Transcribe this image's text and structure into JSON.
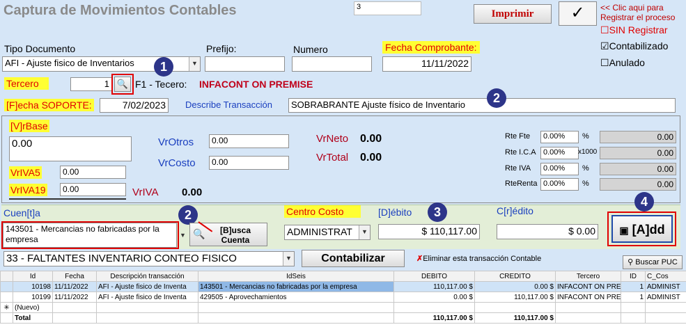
{
  "title": "Captura de Movimientos Contables",
  "top_input_value": "3",
  "print_label": "Imprimir",
  "register_hint_line1": "<< Clic aqui para",
  "register_hint_line2": "Registrar el proceso",
  "checks": {
    "sin_registrar": "SIN Registrar",
    "contabilizado": "Contabilizado",
    "anulado": "Anulado",
    "sin_registrar_mark": "☐",
    "contabilizado_mark": "☑",
    "anulado_mark": "☐"
  },
  "labels": {
    "tipo_documento": "Tipo Documento",
    "prefijo": "Prefijo:",
    "numero": "Numero",
    "fecha_comprobante": "Fecha Comprobante:",
    "tercero": "Tercero",
    "f1_tercero": "F1 - Tecero:",
    "fecha_soporte": "[F]echa SOPORTE:",
    "describe_transaccion": "Describe Transacción",
    "vrbase": "[V]rBase",
    "vrotros": "VrOtros",
    "vrcosto": "VrCosto",
    "vrneto": "VrNeto",
    "vrtotal": "VrTotal",
    "vriva5": "VrIVA5",
    "vriva19": "VrIVA19",
    "vriva": "VrIVA",
    "rte_fte": "Rte Fte",
    "rte_ica": "Rte I.C.A",
    "rte_iva": "Rte IVA",
    "rte_renta": "RteRenta",
    "pct": "%",
    "x1000": "x1000",
    "cuenta": "Cuen[t]a",
    "buscar_cuenta_1": "[B]usca",
    "buscar_cuenta_2": "Cuenta",
    "centro_costo": "Centro Costo",
    "debito": "[D]ébito",
    "credito": "C[r]édito",
    "add": "[A]dd",
    "contabilizar": "Contabilizar",
    "eliminar": "Eliminar esta transacción Contable",
    "buscar_puc": "Buscar PUC"
  },
  "values": {
    "tipo_documento": "AFI - Ajuste fisico de Inventarios",
    "prefijo": "",
    "numero": "",
    "fecha_comprobante": "11/11/2022",
    "tercero_id": "1",
    "tercero_name": "INFACONT ON PREMISE",
    "fecha_soporte": "7/02/2023",
    "describe_transaccion": "SOBRABRANTE Ajuste físico de Inventario",
    "vrbase": "0.00",
    "vrotros": "0.00",
    "vrcosto": "0.00",
    "vrneto": "0.00",
    "vrtotal": "0.00",
    "vriva5": "0.00",
    "vriva19": "0.00",
    "vriva": "0.00",
    "rte_fte_pct": "0.00%",
    "rte_ica_pct": "0.00%",
    "rte_iva_pct": "0.00%",
    "rte_renta_pct": "0.00%",
    "rte_fte_val": "0.00",
    "rte_ica_val": "0.00",
    "rte_iva_val": "0.00",
    "rte_renta_val": "0.00",
    "cuenta": "143501 - Mercancias no fabricadas por la empresa",
    "centro_costo": "ADMINISTRAT",
    "debito": "$ 110,117.00",
    "credito": "$ 0.00",
    "concepto": "33 - FALTANTES INVENTARIO CONTEO FISICO"
  },
  "markers": [
    "1",
    "2",
    "2",
    "3",
    "4"
  ],
  "grid": {
    "columns": [
      "Id",
      "Fecha",
      "Descripción transacción",
      "IdSeis",
      "DEBITO",
      "CREDITO",
      "Tercero",
      "ID",
      "C_Cos"
    ],
    "rows": [
      [
        "10198",
        "11/11/2022",
        "AFI - Ajuste fisico de Inventa",
        "143501 - Mercancias no fabricadas por la empresa",
        "110,117.00 $",
        "0.00 $",
        "INFACONT ON PRE",
        "1",
        "ADMINIST"
      ],
      [
        "10199",
        "11/11/2022",
        "AFI - Ajuste fisico de Inventa",
        "429505 - Aprovechamientos",
        "0.00 $",
        "110,117.00 $",
        "INFACONT ON PRE",
        "1",
        "ADMINIST"
      ]
    ],
    "new_row_label": "(Nuevo)",
    "new_row_marker": "✳",
    "total_label": "Total",
    "total_debito": "110,117.00 $",
    "total_credito": "110,117.00 $"
  }
}
